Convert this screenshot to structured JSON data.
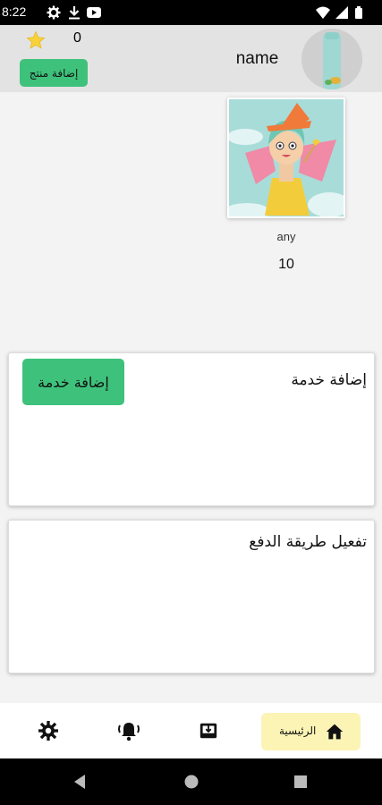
{
  "status_bar": {
    "time": "8:22",
    "icons_left": [
      "gear-icon",
      "download-icon",
      "youtube-icon"
    ],
    "icons_right": [
      "wifi-icon",
      "signal-icon",
      "battery-icon"
    ]
  },
  "header": {
    "star_count": "0",
    "add_product_label": "إضافة منتج",
    "user_name": "name"
  },
  "product": {
    "name": "any",
    "price": "10"
  },
  "service_panel": {
    "title": "إضافة خدمة",
    "add_service_label": "إضافة خدمة"
  },
  "payment_panel": {
    "title": "تفعيل طريقة الدفع"
  },
  "bottom_nav": {
    "items": [
      {
        "name": "settings",
        "icon": "gear-icon"
      },
      {
        "name": "notifications",
        "icon": "bell-icon"
      },
      {
        "name": "inbox",
        "icon": "inbox-icon"
      },
      {
        "name": "home",
        "icon": "home-icon",
        "label": "الرئيسية",
        "active": true
      }
    ]
  },
  "colors": {
    "accent_green": "#3ec27b",
    "header_bg": "#e3e3e3",
    "active_nav_bg": "#fbf4b5"
  }
}
